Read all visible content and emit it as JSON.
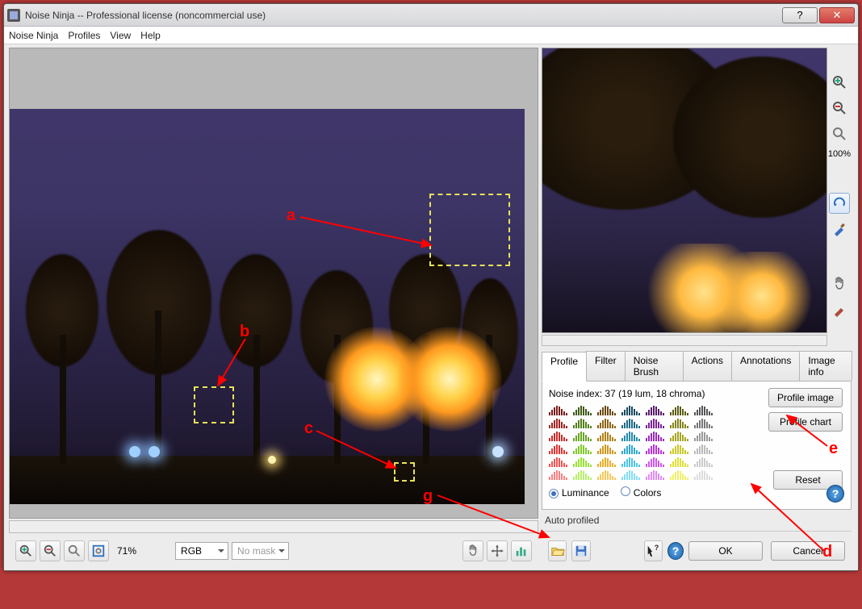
{
  "title": "Noise Ninja -- Professional license (noncommercial use)",
  "menu": [
    "Noise Ninja",
    "Profiles",
    "View",
    "Help"
  ],
  "zoom_main": "71%",
  "combo_channel": "RGB",
  "combo_mask": "No mask",
  "zoom_side": "100%",
  "tabs": [
    "Profile",
    "Filter",
    "Noise Brush",
    "Actions",
    "Annotations",
    "Image info"
  ],
  "active_tab": 0,
  "noise_index_label": "Noise index:",
  "noise_index_value": "37 (19 lum, 18 chroma)",
  "radio_luminance": "Luminance",
  "radio_colors": "Colors",
  "btn_profile_image": "Profile image",
  "btn_profile_chart": "Profile chart",
  "btn_reset": "Reset",
  "status_text": "Auto profiled",
  "btn_ok": "OK",
  "btn_cancel": "Cancel",
  "annotations": {
    "a": "a",
    "b": "b",
    "c": "c",
    "d": "d",
    "e": "e",
    "g": "g"
  },
  "profile_colors": [
    "#7a1c1c",
    "#3e5a18",
    "#6a4a10",
    "#184b5f",
    "#5a1c6e",
    "#5d5d14",
    "#555",
    "#a02424",
    "#54801d",
    "#8e6514",
    "#1f6b87",
    "#7b2494",
    "#84841b",
    "#777",
    "#c62d2d",
    "#6aa524",
    "#b08018",
    "#278bab",
    "#9a2cb9",
    "#a6a622",
    "#999",
    "#e13636",
    "#82c92b",
    "#d0981d",
    "#2fa9cd",
    "#b835da",
    "#c9c928",
    "#bbb",
    "#f15353",
    "#9ae03a",
    "#e9af2c",
    "#4ec4e6",
    "#cc57ec",
    "#e0e03a",
    "#ccc",
    "#fa8080",
    "#b9ef6d",
    "#f4c95d",
    "#86dcf2",
    "#df8cf4",
    "#efef6d",
    "#ddd"
  ]
}
